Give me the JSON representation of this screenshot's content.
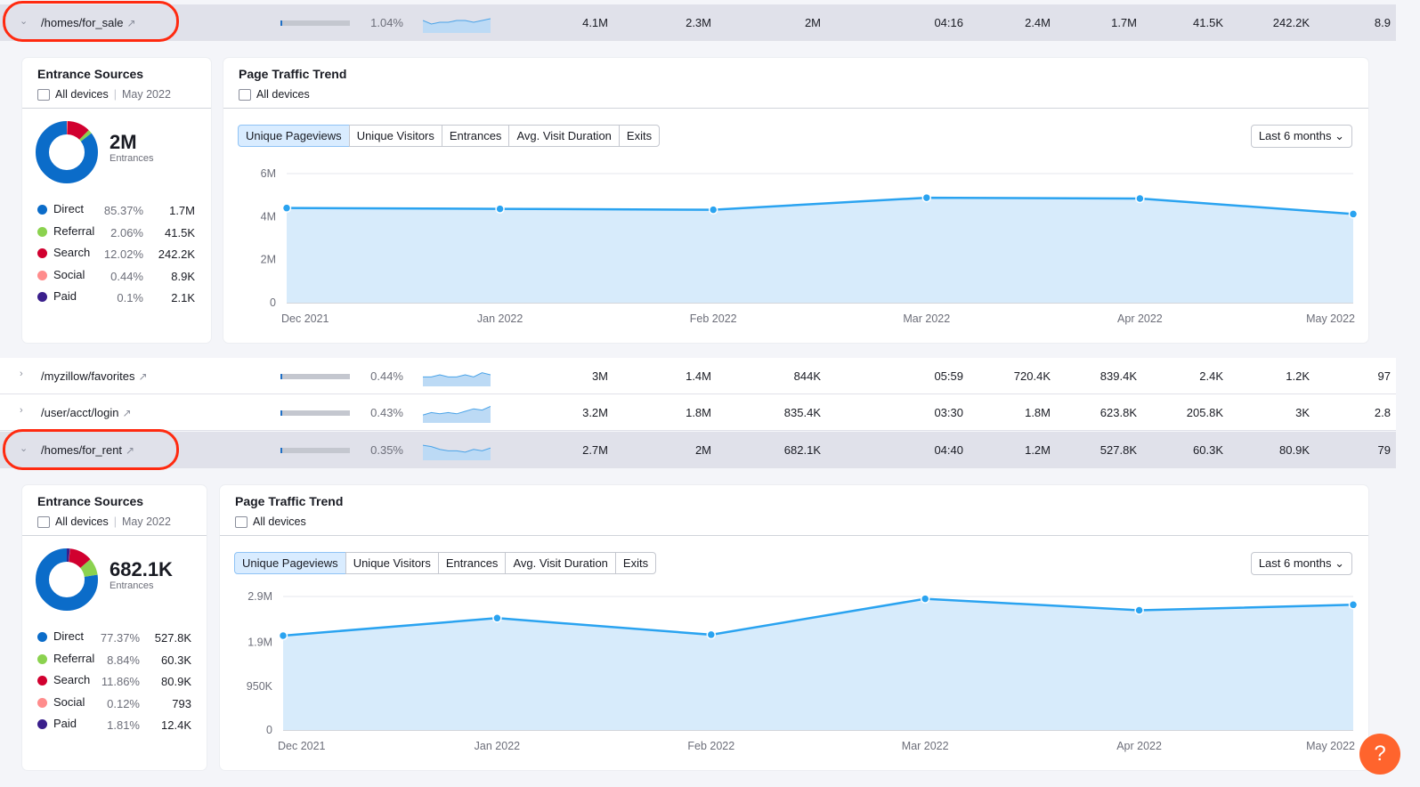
{
  "colors": {
    "direct": "#0b6cc9",
    "referral": "#8bd24f",
    "search": "#d1002f",
    "social": "#ff8c8c",
    "paid": "#3a1f8c",
    "line": "#2aa3f0",
    "area": "#d7ebfb"
  },
  "rows": [
    {
      "url": "/homes/for_sale",
      "share": 1.04,
      "pct": "1.04%",
      "values": [
        "4.1M",
        "2.3M",
        "2M",
        "04:16",
        "2.4M",
        "1.7M",
        "41.5K",
        "242.2K",
        "8.9"
      ],
      "expanded": true,
      "spark": [
        3,
        5,
        4,
        4,
        3,
        3,
        4,
        3,
        2
      ]
    },
    {
      "url": "/myzillow/favorites",
      "share": 0.44,
      "pct": "0.44%",
      "values": [
        "3M",
        "1.4M",
        "844K",
        "05:59",
        "720.4K",
        "839.4K",
        "2.4K",
        "1.2K",
        "97"
      ],
      "expanded": false,
      "spark": [
        4,
        4,
        3,
        4,
        4,
        3,
        4,
        2,
        3
      ]
    },
    {
      "url": "/user/acct/login",
      "share": 0.43,
      "pct": "0.43%",
      "values": [
        "3.2M",
        "1.8M",
        "835.4K",
        "03:30",
        "1.8M",
        "623.8K",
        "205.8K",
        "3K",
        "2.8"
      ],
      "expanded": false,
      "spark": [
        8,
        6,
        7,
        6,
        7,
        5,
        3,
        4,
        1
      ]
    },
    {
      "url": "/homes/for_rent",
      "share": 0.35,
      "pct": "0.35%",
      "values": [
        "2.7M",
        "2M",
        "682.1K",
        "04:40",
        "1.2M",
        "527.8K",
        "60.3K",
        "80.9K",
        "79"
      ],
      "expanded": true,
      "spark": [
        2,
        3,
        5,
        6,
        6,
        7,
        5,
        6,
        4
      ]
    }
  ],
  "panels": [
    {
      "sources": {
        "title": "Entrance Sources",
        "device": "All devices",
        "date": "May 2022",
        "total": "2M",
        "total_label": "Entrances",
        "items": [
          {
            "name": "Direct",
            "pct": "85.37%",
            "count": "1.7M",
            "share": 85.37
          },
          {
            "name": "Referral",
            "pct": "2.06%",
            "count": "41.5K",
            "share": 2.06
          },
          {
            "name": "Search",
            "pct": "12.02%",
            "count": "242.2K",
            "share": 12.02
          },
          {
            "name": "Social",
            "pct": "0.44%",
            "count": "8.9K",
            "share": 0.44
          },
          {
            "name": "Paid",
            "pct": "0.1%",
            "count": "2.1K",
            "share": 0.1
          }
        ]
      },
      "trend": {
        "title": "Page Traffic Trend",
        "device": "All devices",
        "tabs": [
          "Unique Pageviews",
          "Unique Visitors",
          "Entrances",
          "Avg. Visit Duration",
          "Exits"
        ],
        "active_tab": "Unique Pageviews",
        "period": "Last 6 months"
      }
    },
    {
      "sources": {
        "title": "Entrance Sources",
        "device": "All devices",
        "date": "May 2022",
        "total": "682.1K",
        "total_label": "Entrances",
        "items": [
          {
            "name": "Direct",
            "pct": "77.37%",
            "count": "527.8K",
            "share": 77.37
          },
          {
            "name": "Referral",
            "pct": "8.84%",
            "count": "60.3K",
            "share": 8.84
          },
          {
            "name": "Search",
            "pct": "11.86%",
            "count": "80.9K",
            "share": 11.86
          },
          {
            "name": "Social",
            "pct": "0.12%",
            "count": "793",
            "share": 0.12
          },
          {
            "name": "Paid",
            "pct": "1.81%",
            "count": "12.4K",
            "share": 1.81
          }
        ]
      },
      "trend": {
        "title": "Page Traffic Trend",
        "device": "All devices",
        "tabs": [
          "Unique Pageviews",
          "Unique Visitors",
          "Entrances",
          "Avg. Visit Duration",
          "Exits"
        ],
        "active_tab": "Unique Pageviews",
        "period": "Last 6 months"
      }
    }
  ],
  "chart_data": [
    {
      "type": "area",
      "x": [
        "Dec 2021",
        "Jan 2022",
        "Feb 2022",
        "Mar 2022",
        "Apr 2022",
        "May 2022"
      ],
      "series": [
        {
          "values": [
            4400000,
            4360000,
            4320000,
            4880000,
            4840000,
            4120000
          ]
        }
      ],
      "yticks": [
        0,
        2000000,
        4000000,
        6000000
      ],
      "ytick_labels": [
        "0",
        "2M",
        "4M",
        "6M"
      ],
      "ylim": [
        0,
        6000000
      ],
      "grid": true
    },
    {
      "type": "area",
      "x": [
        "Dec 2021",
        "Jan 2022",
        "Feb 2022",
        "Mar 2022",
        "Apr 2022",
        "May 2022"
      ],
      "series": [
        {
          "values": [
            2050000,
            2430000,
            2070000,
            2850000,
            2600000,
            2720000
          ]
        }
      ],
      "yticks": [
        0,
        950000,
        1900000,
        2900000
      ],
      "ytick_labels": [
        "0",
        "950K",
        "1.9M",
        "2.9M"
      ],
      "ylim": [
        0,
        2900000
      ],
      "grid": true
    }
  ],
  "help": "?"
}
